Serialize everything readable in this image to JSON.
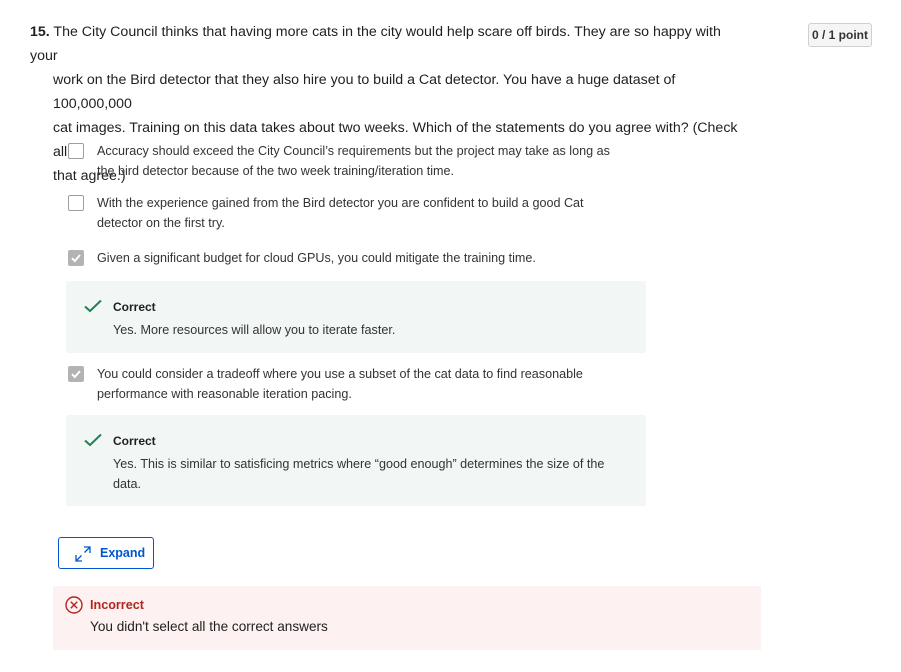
{
  "question": {
    "number": "15.",
    "line1": "The City Council thinks that having more cats in the city would help scare off birds. They are so happy with your",
    "line2": "work on the Bird detector that they also hire you to build a Cat detector. You have a huge dataset of 100,000,000",
    "line3": "cat images. Training on this data takes about two weeks. Which of the statements do you agree with? (Check all",
    "line4": "that agree.)"
  },
  "score": "0 / 1 point",
  "options": [
    {
      "line1": "Accuracy should exceed the City Council’s requirements but the project may take as long as",
      "line2": "the bird detector because of the two week training/iteration time.",
      "checked": false
    },
    {
      "line1": "With the experience gained from the Bird detector you are confident to build a good Cat",
      "line2": "detector on the first try.",
      "checked": false
    },
    {
      "line1": "Given a significant budget for cloud GPUs, you could mitigate the training time.",
      "checked": true,
      "feedback": {
        "label": "Correct",
        "line1": "Yes. More resources will allow you to iterate faster."
      }
    },
    {
      "line1": "You could consider a tradeoff where you use a subset of the cat data to find reasonable",
      "line2": "performance with reasonable iteration pacing.",
      "checked": true,
      "feedback": {
        "label": "Correct",
        "line1": "Yes. This is similar to satisficing metrics where “good enough” determines the size of the",
        "line2": "data."
      }
    }
  ],
  "expand_label": "Expand",
  "result": {
    "label": "Incorrect",
    "message": "You didn't select all the correct answers"
  },
  "colors": {
    "accent": "#0056d2",
    "correct": "#1f8354",
    "incorrect": "#b3261e",
    "feedback_bg": "#f2f7f5",
    "incorrect_bg": "#fdf1f1"
  }
}
